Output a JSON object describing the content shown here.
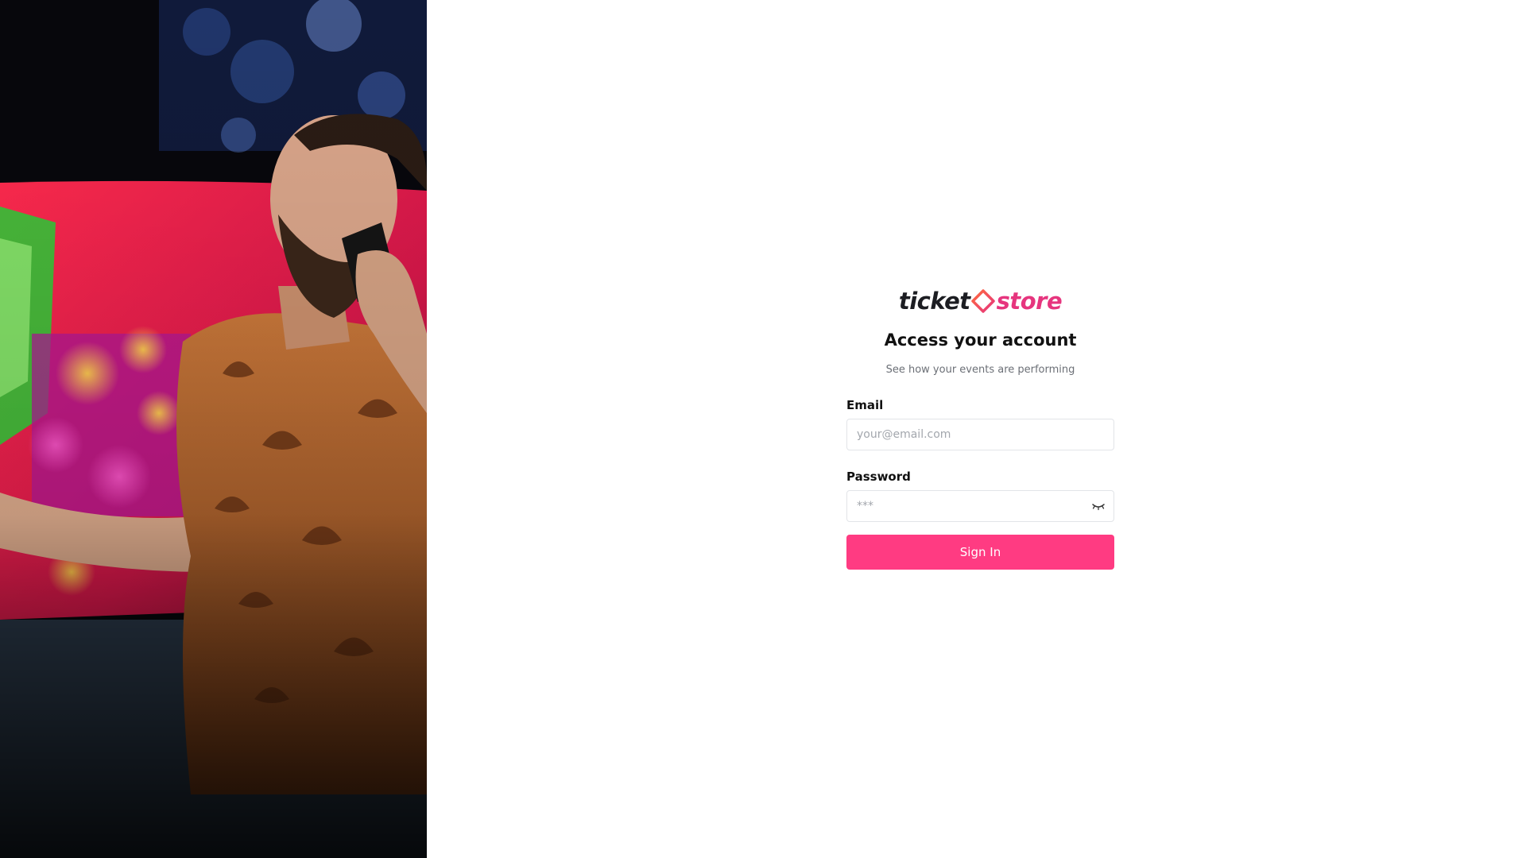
{
  "brand": {
    "logo_left": "ticket",
    "logo_right": "store",
    "accent": "#e6357e",
    "button_color": "#ff3b82"
  },
  "hero": {
    "image": "man-on-phone-photo"
  },
  "form": {
    "title": "Access your account",
    "subtitle": "See how your events are performing",
    "email_label": "Email",
    "email_placeholder": "your@email.com",
    "password_label": "Password",
    "password_placeholder": "***",
    "password_toggle_icon": "eye-closed-icon",
    "submit_label": "Sign In"
  }
}
